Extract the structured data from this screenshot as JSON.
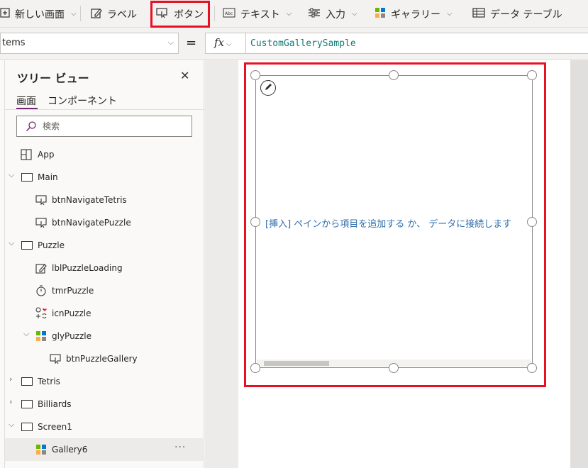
{
  "ribbon": {
    "new_screen": "新しい画面",
    "label": "ラベル",
    "button": "ボタン",
    "text": "テキスト",
    "input": "入力",
    "gallery": "ギャラリー",
    "data_table": "データ テーブル"
  },
  "formula_bar": {
    "property": "tems",
    "equals": "=",
    "fx": "fx",
    "formula": "CustomGallerySample"
  },
  "tree_view": {
    "title": "ツリー ビュー",
    "tabs": [
      "画面",
      "コンポーネント"
    ],
    "active_tab": "画面",
    "search_placeholder": "検索",
    "app_label": "App",
    "nodes": {
      "main": "Main",
      "btn_navigate_tetris": "btnNavigateTetris",
      "btn_navigate_puzzle": "btnNavigatePuzzle",
      "puzzle": "Puzzle",
      "lbl_puzzle_loading": "lblPuzzleLoading",
      "tmr_puzzle": "tmrPuzzle",
      "icn_puzzle": "icnPuzzle",
      "gly_puzzle": "glyPuzzle",
      "btn_puzzle_gallery": "btnPuzzleGallery",
      "tetris": "Tetris",
      "billiards": "Billiards",
      "screen1": "Screen1",
      "gallery6": "Gallery6"
    },
    "more": "···"
  },
  "canvas": {
    "gallery_message": "[挿入] ペインから項目を追加する か、 データに接続します"
  },
  "colors": {
    "accent": "#742774",
    "highlight": "#e81123",
    "formula_text": "#0e7a79",
    "message_text": "#2f6ead"
  }
}
